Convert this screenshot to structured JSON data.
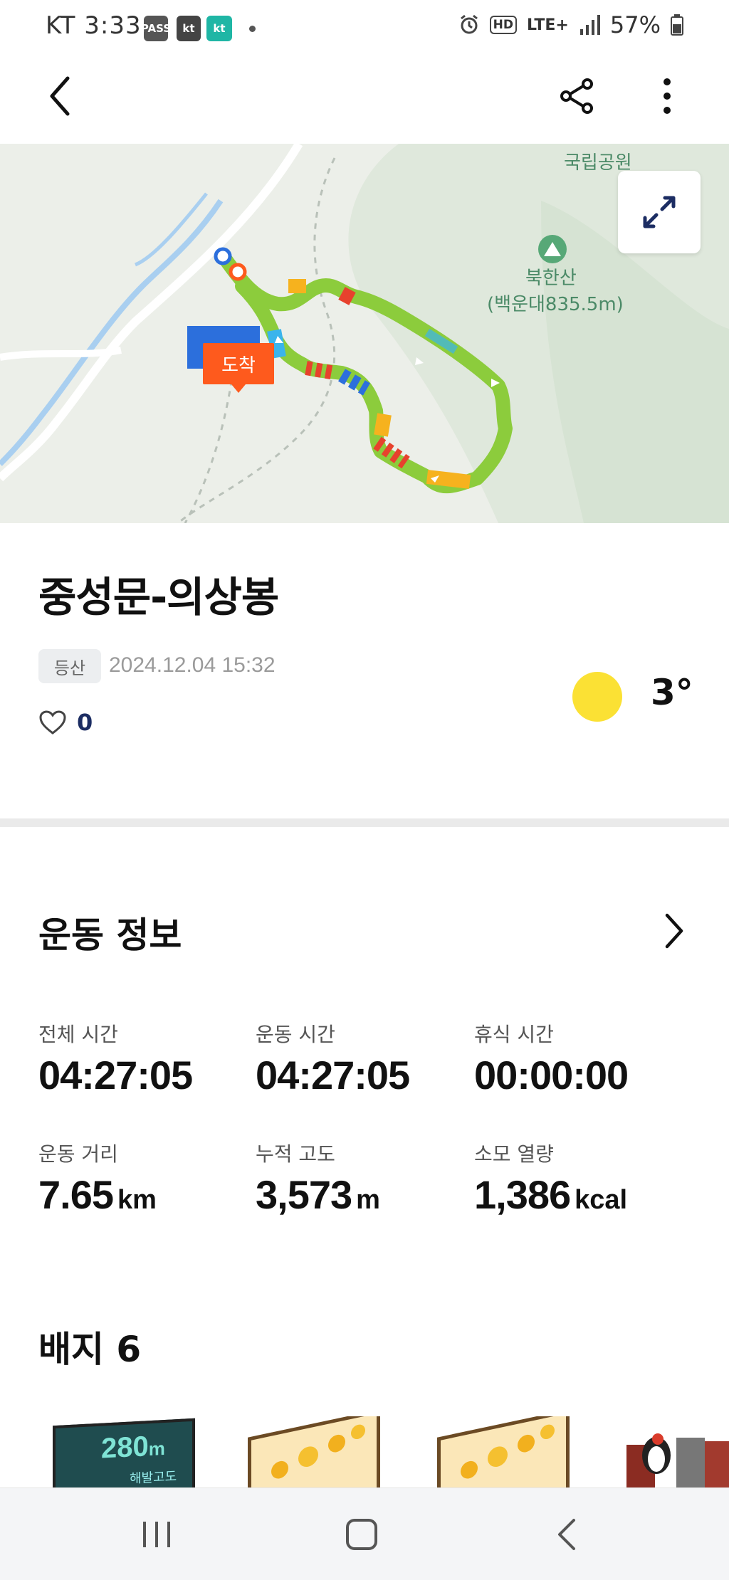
{
  "status_bar": {
    "carrier_time": "KT 3:33",
    "badges": [
      "PASS",
      "kt",
      "kt"
    ],
    "hd": "HD",
    "network": "LTE+",
    "battery": "57%"
  },
  "map": {
    "park_label": "국립공원",
    "mountain_name": "북한산",
    "mountain_peak": "(백운대835.5m)",
    "arrive_tag": "도착"
  },
  "activity": {
    "title": "중성문-의상봉",
    "category": "등산",
    "datetime": "2024.12.04 15:32",
    "likes": "0",
    "temperature": "3°"
  },
  "exercise_info": {
    "heading": "운동 정보",
    "stats": [
      {
        "label": "전체 시간",
        "value": "04:27:05",
        "unit": ""
      },
      {
        "label": "운동 시간",
        "value": "04:27:05",
        "unit": ""
      },
      {
        "label": "휴식 시간",
        "value": "00:00:00",
        "unit": ""
      },
      {
        "label": "운동 거리",
        "value": "7.65",
        "unit": "km"
      },
      {
        "label": "누적 고도",
        "value": "3,573",
        "unit": "m"
      },
      {
        "label": "소모 열량",
        "value": "1,386",
        "unit": "kcal"
      }
    ]
  },
  "badges": {
    "heading": "배지 6",
    "first_badge_value": "280",
    "first_badge_unit": "m",
    "first_badge_caption": "해발고도"
  },
  "colors": {
    "route_green": "#8ccc3c",
    "route_blue": "#3ab4ec",
    "route_orange": "#f6b21e",
    "arrive_tag": "#fe5a1d",
    "sun": "#fbe134",
    "like_count": "#1c2d63"
  },
  "icons": [
    "back-icon",
    "share-icon",
    "more-vert-icon",
    "expand-icon",
    "heart-icon",
    "chevron-right-icon",
    "recents-icon",
    "home-icon",
    "nav-back-icon"
  ]
}
